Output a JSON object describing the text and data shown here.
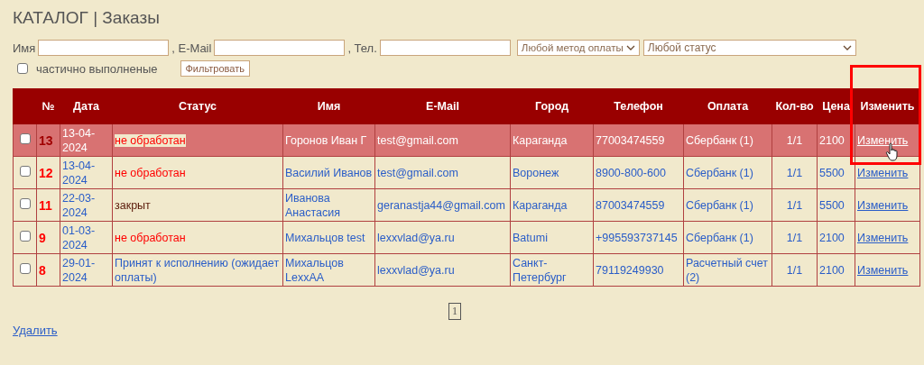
{
  "page_title": "КАТАЛОГ | Заказы",
  "filters": {
    "name_label": "Имя",
    "email_label": ", E-Mail",
    "phone_label": ", Тел.",
    "payment_select": "Любой метод оплаты",
    "status_select": "Любой статус",
    "partial_label": "частично выполненые",
    "partial_checked": false,
    "filter_button": "Фильтровать"
  },
  "table": {
    "columns": [
      "№",
      "Дата",
      "Статус",
      "Имя",
      "E-Mail",
      "Город",
      "Телефон",
      "Оплата",
      "Кол-во",
      "Цена",
      "Изменить"
    ],
    "rows": [
      {
        "selected": true,
        "checked": false,
        "number": "13",
        "date": "13-04-2024",
        "status": "не обработан",
        "color": "#ff0000",
        "name": "Горонов Иван Г",
        "email": "test@gmail.com",
        "city": "Караганда",
        "phone": "77003474559",
        "payment": "Сбербанк (1)",
        "qty": "1/1",
        "price": "2100",
        "edit": "Изменить"
      },
      {
        "selected": false,
        "checked": false,
        "number": "12",
        "date": "13-04-2024",
        "status": "не обработан",
        "color": "#ff0000",
        "name": "Василий Иванов",
        "email": "test@gmail.com",
        "city": "Воронеж",
        "phone": "8900-800-600",
        "payment": "Сбербанк (1)",
        "qty": "1/1",
        "price": "5500",
        "edit": "Изменить"
      },
      {
        "selected": false,
        "checked": false,
        "number": "11",
        "date": "22-03-2024",
        "status": "закрыт",
        "color": "#5a1a0a",
        "name": "Иванова Анастасия",
        "email": "geranastja44@gmail.com",
        "city": "Караганда",
        "phone": "87003474559",
        "payment": "Сбербанк (1)",
        "qty": "1/1",
        "price": "5500",
        "edit": "Изменить"
      },
      {
        "selected": false,
        "checked": false,
        "number": "9",
        "date": "01-03-2024",
        "status": "не обработан",
        "color": "#ff0000",
        "name": "Михальцов test",
        "email": "lexxvlad@ya.ru",
        "city": "Batumi",
        "phone": "+995593737145",
        "payment": "Сбербанк (1)",
        "qty": "1/1",
        "price": "2100",
        "edit": "Изменить"
      },
      {
        "selected": false,
        "checked": false,
        "number": "8",
        "date": "29-01-2024",
        "status": "Принят к исполнению (ожидает оплаты)",
        "color": "#2a5dc8",
        "name": "Михальцов LexxAA",
        "email": "lexxvlad@ya.ru",
        "city": "Санкт-Петербург",
        "phone": "79119249930",
        "payment": "Расчетный счет (2)",
        "qty": "1/1",
        "price": "2100",
        "edit": "Изменить"
      }
    ]
  },
  "pagination": [
    {
      "label": "1",
      "selected": true
    }
  ],
  "delete_link": "Удалить"
}
